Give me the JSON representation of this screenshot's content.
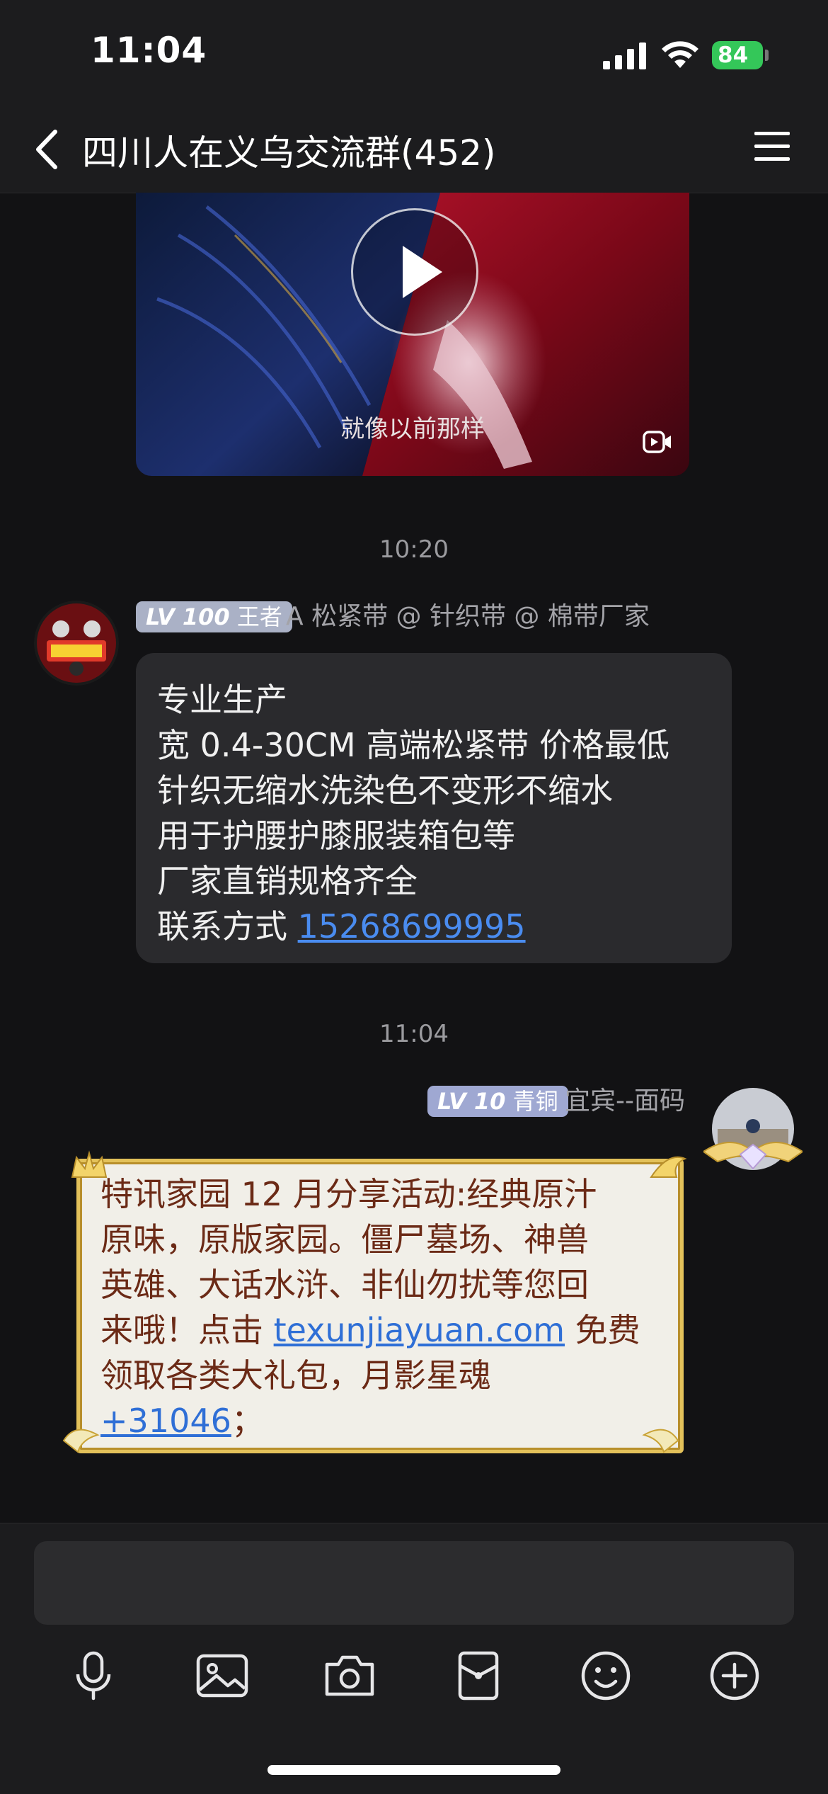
{
  "status_bar": {
    "time": "11:04",
    "battery": "84",
    "icons": [
      "signal-icon",
      "wifi-icon",
      "battery-icon"
    ]
  },
  "header": {
    "back_icon": "chevron-left-icon",
    "title": "四川人在义乌交流群(452)",
    "menu_icon": "menu-icon"
  },
  "video": {
    "caption": "就像以前那样",
    "play_icon": "play-icon",
    "corner_icon": "video-call-icon"
  },
  "messages": [
    {
      "timestamp": "10:20",
      "level": {
        "lv": "LV 100",
        "rank": "王者"
      },
      "sender": "A 松紧带 @ 针织带 @ 棉带厂家",
      "lines": [
        "专业生产",
        "宽 0.4-30CM 高端松紧带 价格最低",
        "针织无缩水洗染色不变形不缩水",
        "用于护腰护膝服装箱包等",
        "厂家直销规格齐全"
      ],
      "contact_label": "联系方式 ",
      "contact_number": "15268699995"
    },
    {
      "timestamp": "11:04",
      "level": {
        "lv": "LV 10",
        "rank": "青铜"
      },
      "sender": "宜宾--面码",
      "lines": [
        "特讯家园 12 月分享活动:经典原汁",
        "原味，原版家园。僵尸墓场、神兽",
        "英雄、大话水浒、非仙勿扰等您回"
      ],
      "line4_prefix": "来哦！点击 ",
      "link": "texunjiayuan.com",
      "line4_suffix": " 免费",
      "line5": "领取各类大礼包，月影星魂",
      "number": "+31046",
      "number_suffix": "；"
    }
  ],
  "input": {
    "placeholder": "",
    "value": ""
  },
  "toolbar": [
    "microphone-icon",
    "image-icon",
    "camera-icon",
    "red-packet-icon",
    "emoji-icon",
    "plus-icon"
  ],
  "colors": {
    "background": "#121214",
    "bar": "#1c1c1e",
    "link": "#4a8cf0",
    "battery": "#34c759",
    "bubble_border": "#e3c15a"
  }
}
